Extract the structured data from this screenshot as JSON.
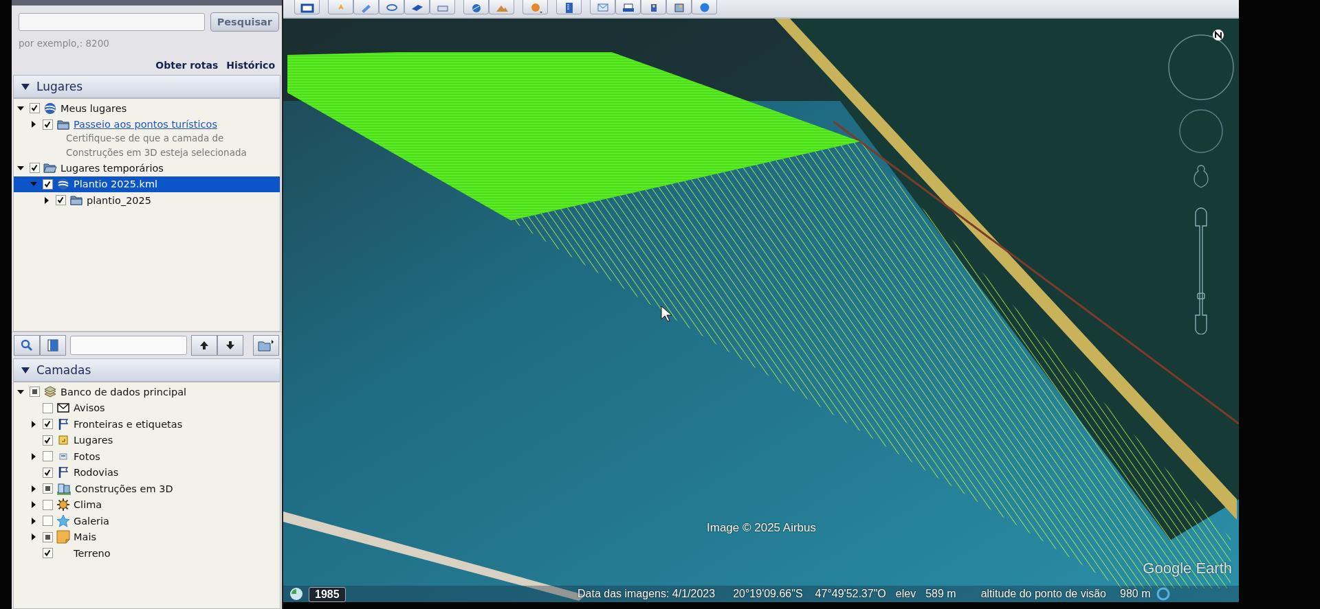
{
  "search": {
    "button": "Pesquisar",
    "hint": "por exemplo,: 8200",
    "links": [
      "Obter rotas",
      "Histórico"
    ]
  },
  "places": {
    "title": "Lugares",
    "expanded": true,
    "items": [
      {
        "label": "Meus lugares",
        "kind": "globe",
        "checked": true,
        "partial": false,
        "expanded": true,
        "selected": false,
        "link": false,
        "children": [
          {
            "label": "Passeio aos pontos turísticos",
            "kind": "folder",
            "checked": true,
            "partial": false,
            "expanded": false,
            "selected": false,
            "link": true,
            "description": "Certifique-se de que a camada de Construções em 3D esteja selecionada"
          }
        ]
      },
      {
        "label": "Lugares temporários",
        "kind": "folder-open",
        "checked": true,
        "partial": false,
        "expanded": true,
        "selected": false,
        "link": false,
        "children": [
          {
            "label": "Plantio 2025.kml",
            "kind": "globe",
            "checked": true,
            "partial": false,
            "expanded": true,
            "selected": true,
            "link": false,
            "children": [
              {
                "label": "plantio_2025",
                "kind": "folder",
                "checked": true,
                "partial": false,
                "expanded": false,
                "selected": false,
                "link": false
              }
            ]
          }
        ]
      }
    ]
  },
  "layers": {
    "title": "Camadas",
    "expanded": true,
    "items": [
      {
        "label": "Banco de dados principal",
        "kind": "database",
        "checked": false,
        "partial": true,
        "expanded": true,
        "selected": false,
        "children": [
          {
            "label": "Avisos",
            "kind": "envelope",
            "checked": false,
            "partial": false,
            "selected": false
          },
          {
            "label": "Fronteiras e etiquetas",
            "kind": "flag",
            "checked": true,
            "partial": false,
            "expanded": false,
            "selected": false
          },
          {
            "label": "Lugares",
            "kind": "placemark",
            "checked": true,
            "partial": false,
            "selected": false
          },
          {
            "label": "Fotos",
            "kind": "photo",
            "checked": false,
            "partial": false,
            "expanded": false,
            "selected": false
          },
          {
            "label": "Rodovias",
            "kind": "flag",
            "checked": true,
            "partial": false,
            "selected": false
          },
          {
            "label": "Construções em 3D",
            "kind": "building",
            "checked": false,
            "partial": true,
            "expanded": false,
            "selected": false
          },
          {
            "label": "Clima",
            "kind": "sun",
            "checked": false,
            "partial": false,
            "expanded": false,
            "selected": false
          },
          {
            "label": "Galeria",
            "kind": "star",
            "checked": false,
            "partial": false,
            "expanded": false,
            "selected": false
          },
          {
            "label": "Mais",
            "kind": "note",
            "checked": false,
            "partial": true,
            "expanded": false,
            "selected": false
          },
          {
            "label": "Terreno",
            "kind": "plain",
            "checked": true,
            "partial": false,
            "selected": false
          }
        ]
      }
    ]
  },
  "map": {
    "year_badge": "1985",
    "attribution": "Image © 2025 Airbus",
    "logo": "Google Earth",
    "zoom_slider": {
      "level": 0.3
    },
    "status": {
      "date": "Data das imagens: 4/1/2023",
      "latitude": "20°19'09.66\"S",
      "longitude": "47°49'52.37\"O",
      "elev_label": "elev",
      "elev": "589 m",
      "eye_label": "altitude do ponto de visão",
      "eye": "980 m"
    }
  }
}
